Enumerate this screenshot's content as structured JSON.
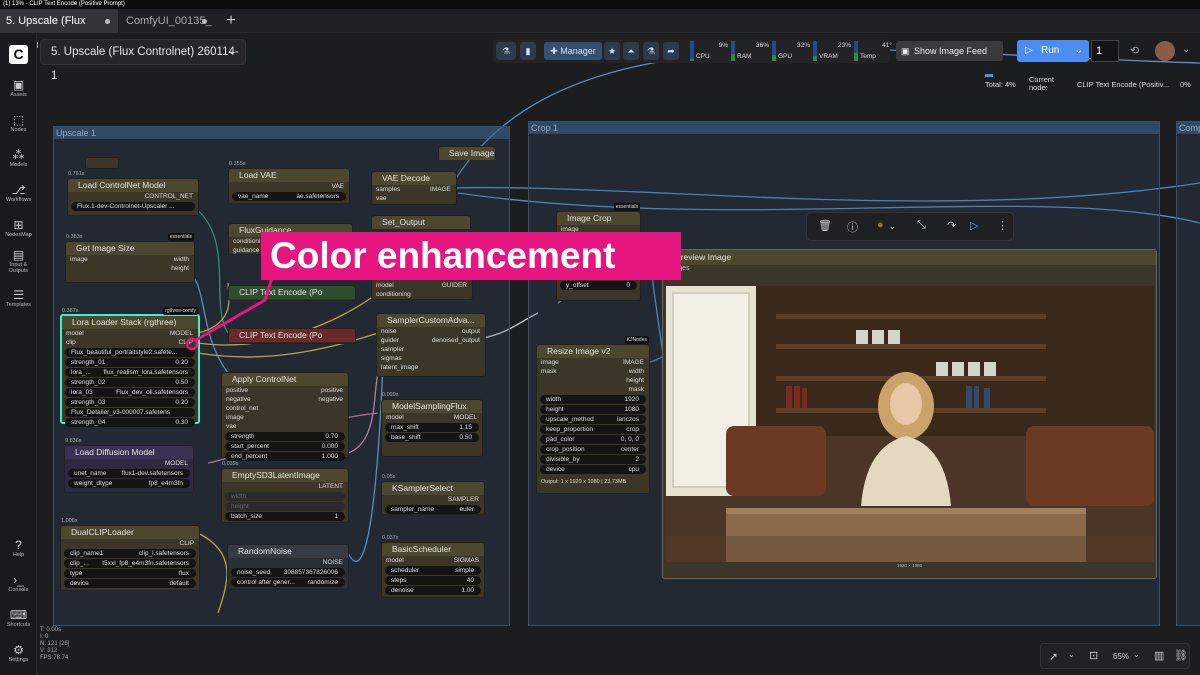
{
  "window_title": "(1) 13% - CLIP Text Encode (Positive Prompt)",
  "tabs": [
    {
      "label": "5. Upscale (Flux Contro...",
      "active": true
    },
    {
      "label": "ComfyUI_00135_",
      "active": false
    }
  ],
  "workflow_title": "5. Upscale (Flux Controlnet) 260114-1",
  "sidebar": [
    {
      "label": "Assets",
      "icon": "folder-icon"
    },
    {
      "label": "Nodes",
      "icon": "nodes-icon"
    },
    {
      "label": "Models",
      "icon": "models-icon"
    },
    {
      "label": "Workflows",
      "icon": "workflows-icon"
    },
    {
      "label": "NodesMap",
      "icon": "map-icon"
    },
    {
      "label": "Input & Outputs",
      "icon": "io-icon"
    },
    {
      "label": "Templates",
      "icon": "templates-icon"
    },
    {
      "label": "Help",
      "icon": "help-icon"
    },
    {
      "label": "Console",
      "icon": "console-icon"
    },
    {
      "label": "Shortcuts",
      "icon": "keyboard-icon"
    },
    {
      "label": "Settings",
      "icon": "gear-icon"
    }
  ],
  "topbar": {
    "manager": "Manager",
    "meters": [
      {
        "name": "CPU",
        "value": "9%",
        "fraction": 0.09
      },
      {
        "name": "RAM",
        "value": "36%",
        "fraction": 0.36
      },
      {
        "name": "GPU",
        "value": "32%",
        "fraction": 0.32
      },
      {
        "name": "VRAM",
        "value": "23%",
        "fraction": 0.23
      },
      {
        "name": "Temp",
        "value": "41°",
        "fraction": 0.41
      }
    ],
    "show_feed": "Show Image Feed",
    "run": "Run",
    "queue_count": "1"
  },
  "progress": {
    "total": "Total: 4%",
    "current_label": "Current node:",
    "current_node": "CLIP Text Encode (Positiv...",
    "current_pct": "0%"
  },
  "groups": {
    "upscale": "Upscale 1",
    "crop": "Crop 1",
    "third": "Comp"
  },
  "overlay_text": "Color enhancement",
  "nodes": {
    "controlnet": {
      "title": "Load ControlNet Model",
      "out": "CONTROL_NET",
      "value": "Flux.1-dev-Controlnet-Upscaler ...",
      "time": "0.761s"
    },
    "get_image_size": {
      "title": "Get Image Size",
      "time": "0.383s",
      "badge": "essentials",
      "in": "image",
      "outs": [
        "width",
        "height",
        "count"
      ]
    },
    "lora": {
      "title": "Lora Loader Stack (rgthree)",
      "time": "0.387s",
      "badge": "rgthree-comfy",
      "ins": [
        "model",
        "clip"
      ],
      "outs": [
        "MODEL",
        "CLIP"
      ],
      "widgets": [
        [
          "Flux_beautiful_portraitstyle2.safete...",
          ""
        ],
        [
          "strength_01",
          "0.20"
        ],
        [
          "lora_...",
          "flux_realism_lora.safetensors"
        ],
        [
          "strength_02",
          "0.50"
        ],
        [
          "lora_03",
          "Flux_dev_oil.safetensors"
        ],
        [
          "strength_03",
          "0.20"
        ],
        [
          "Flux_Detailer_v3-000007.safetens",
          ""
        ],
        [
          "strength_04",
          "0.30"
        ]
      ]
    },
    "load_diffusion": {
      "title": "Load Diffusion Model",
      "time": "9.836s",
      "out": "MODEL",
      "widgets": [
        [
          "unet_name",
          "flux1-dev.safetensors"
        ],
        [
          "weight_dtype",
          "fp8_e4m3fn"
        ]
      ]
    },
    "dualclip": {
      "title": "DualCLIPLoader",
      "time": "1.008s",
      "out": "CLIP",
      "widgets": [
        [
          "clip_name1",
          "clip_l.safetensors"
        ],
        [
          "clip_...",
          "t5xxl_fp8_e4m3fn.safetensors"
        ],
        [
          "type",
          "flux"
        ],
        [
          "device",
          "default"
        ]
      ]
    },
    "load_vae": {
      "title": "Load VAE",
      "time": "0.355s",
      "out": "VAE",
      "widgets": [
        [
          "vae_name",
          "ae.safetensors"
        ]
      ]
    },
    "flux_guidance": {
      "title": "FluxGuidance",
      "ins": [
        "conditioning",
        "guidance"
      ]
    },
    "clip_pos": {
      "title": "CLIP Text Encode (Po"
    },
    "clip_neg": {
      "title": "CLIP Text Encode (Po"
    },
    "apply_cn": {
      "title": "Apply ControlNet",
      "ins": [
        "positive",
        "negative",
        "control_net",
        "image",
        "vae"
      ],
      "outs": [
        "positive",
        "negative"
      ],
      "widgets": [
        [
          "strength",
          "0.70"
        ],
        [
          "start_percent",
          "0.000"
        ],
        [
          "end_percent",
          "1.000"
        ]
      ]
    },
    "empty_latent": {
      "title": "EmptySD3LatentImage",
      "time": "0.039s",
      "out": "LATENT",
      "widgets": [
        [
          "width",
          ""
        ],
        [
          "height",
          ""
        ],
        [
          "batch_size",
          "1"
        ]
      ]
    },
    "random_noise": {
      "title": "RandomNoise",
      "out": "NOISE",
      "widgets": [
        [
          "noise_seed",
          "308857367826006"
        ],
        [
          "control after gener...",
          "randomize"
        ]
      ]
    },
    "vae_decode": {
      "title": "VAE Decode",
      "ins": [
        "samples",
        "vae"
      ],
      "out": "IMAGE"
    },
    "save_image": {
      "title": "Save Image"
    },
    "set_output": {
      "title": "Set_Output"
    },
    "guider": {
      "ins": [
        "model",
        "conditioning"
      ],
      "out": "GUIDER"
    },
    "sampler_adv": {
      "title": "SamplerCustomAdva...",
      "ins": [
        "noise",
        "guider",
        "sampler",
        "sigmas",
        "latent_image"
      ],
      "outs": [
        "output",
        "denoised_output"
      ]
    },
    "model_sampling": {
      "title": "ModelSamplingFlux",
      "time": "0.099s",
      "in": "model",
      "out": "MODEL",
      "widgets": [
        [
          "max_shift",
          "1.15"
        ],
        [
          "base_shift",
          "0.50"
        ],
        [
          "width",
          ""
        ],
        [
          "height",
          ""
        ]
      ]
    },
    "ksampler_select": {
      "title": "KSamplerSelect",
      "time": "0.05s",
      "out": "SAMPLER",
      "widgets": [
        [
          "sampler_name",
          "euler"
        ]
      ]
    },
    "basic_scheduler": {
      "title": "BasicScheduler",
      "time": "0.037s",
      "in": "model",
      "out": "SIGMAS",
      "widgets": [
        [
          "scheduler",
          "simple"
        ],
        [
          "steps",
          "40"
        ],
        [
          "denoise",
          "1.00"
        ]
      ]
    },
    "image_crop": {
      "title": "Image Crop",
      "badge": "essentials",
      "ins": [
        "image"
      ],
      "widgets": [
        [
          "x_offset",
          "0"
        ],
        [
          "y_offset",
          "0"
        ]
      ]
    },
    "resize": {
      "title": "Resize Image v2",
      "badge": "KJNodes",
      "ins": [
        "image",
        "mask"
      ],
      "outs": [
        "IMAGE",
        "width",
        "height",
        "mask"
      ],
      "widgets": [
        [
          "width",
          "1920"
        ],
        [
          "height",
          "1080"
        ],
        [
          "upscale_method",
          "lanczos"
        ],
        [
          "keep_proportion",
          "crop"
        ],
        [
          "pad_color",
          "0, 0, 0"
        ],
        [
          "crop_position",
          "center"
        ],
        [
          "divisible_by",
          "2"
        ],
        [
          "device",
          "cpu"
        ]
      ],
      "output_text": "Output: 1 x 1920 x 1080 | 23.73MB"
    },
    "preview": {
      "title": "Preview Image",
      "in": "images",
      "caption": "1920 × 1080"
    }
  },
  "bottom": {
    "zoom": "65%"
  },
  "stats": [
    "T: 0.00s",
    "I: 0",
    "N: 121 [26]",
    "V: 312",
    "FPS:78.74"
  ]
}
